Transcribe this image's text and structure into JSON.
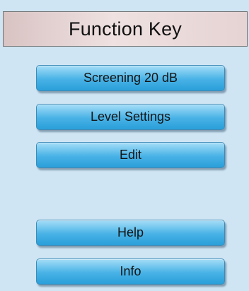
{
  "header": {
    "title": "Function Key"
  },
  "buttons": [
    {
      "label": "Screening 20 dB"
    },
    {
      "label": "Level Settings"
    },
    {
      "label": "Edit"
    },
    {
      "label": "Help"
    },
    {
      "label": "Info"
    }
  ],
  "colors": {
    "background": "#cfe5f3",
    "button_accent": "#48b2e6",
    "header_bg": "#efe1e1"
  }
}
